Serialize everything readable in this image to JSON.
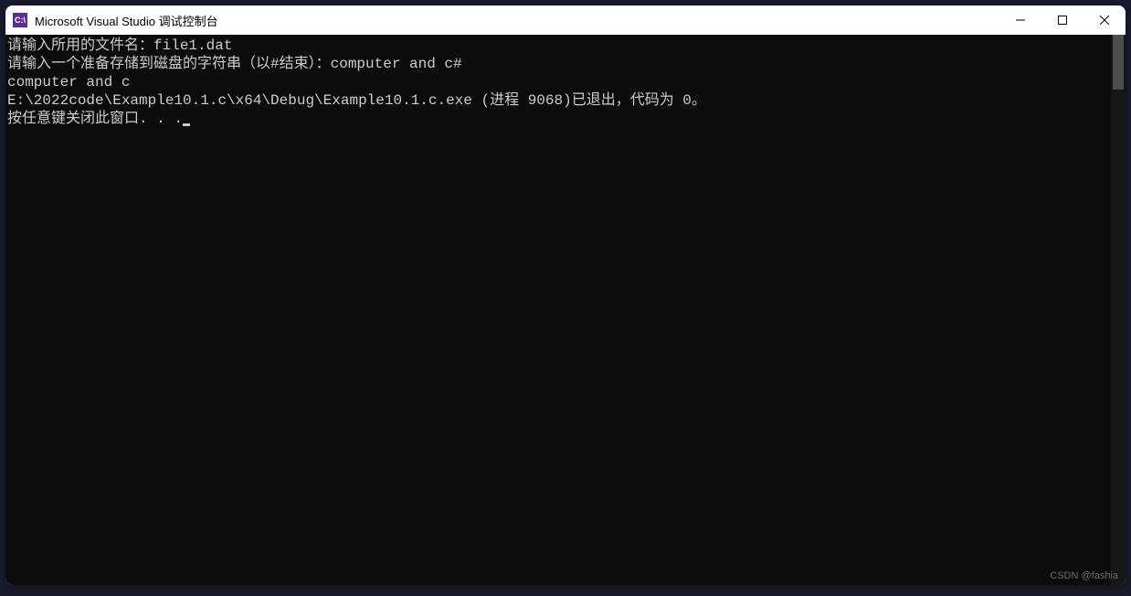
{
  "titlebar": {
    "icon_text": "C:\\",
    "title": "Microsoft Visual Studio 调试控制台"
  },
  "console": {
    "line1_prompt": "请输入所用的文件名：",
    "line1_input": "file1.dat",
    "line2_prompt": "请输入一个准备存储到磁盘的字符串（以#结束）：",
    "line2_input": "computer and c#",
    "line3": "computer and c",
    "line4": "",
    "line5": "E:\\2022code\\Example10.1.c\\x64\\Debug\\Example10.1.c.exe (进程 9068)已退出，代码为 0。",
    "line6": "按任意键关闭此窗口. . ."
  },
  "watermark": "CSDN @fashia"
}
